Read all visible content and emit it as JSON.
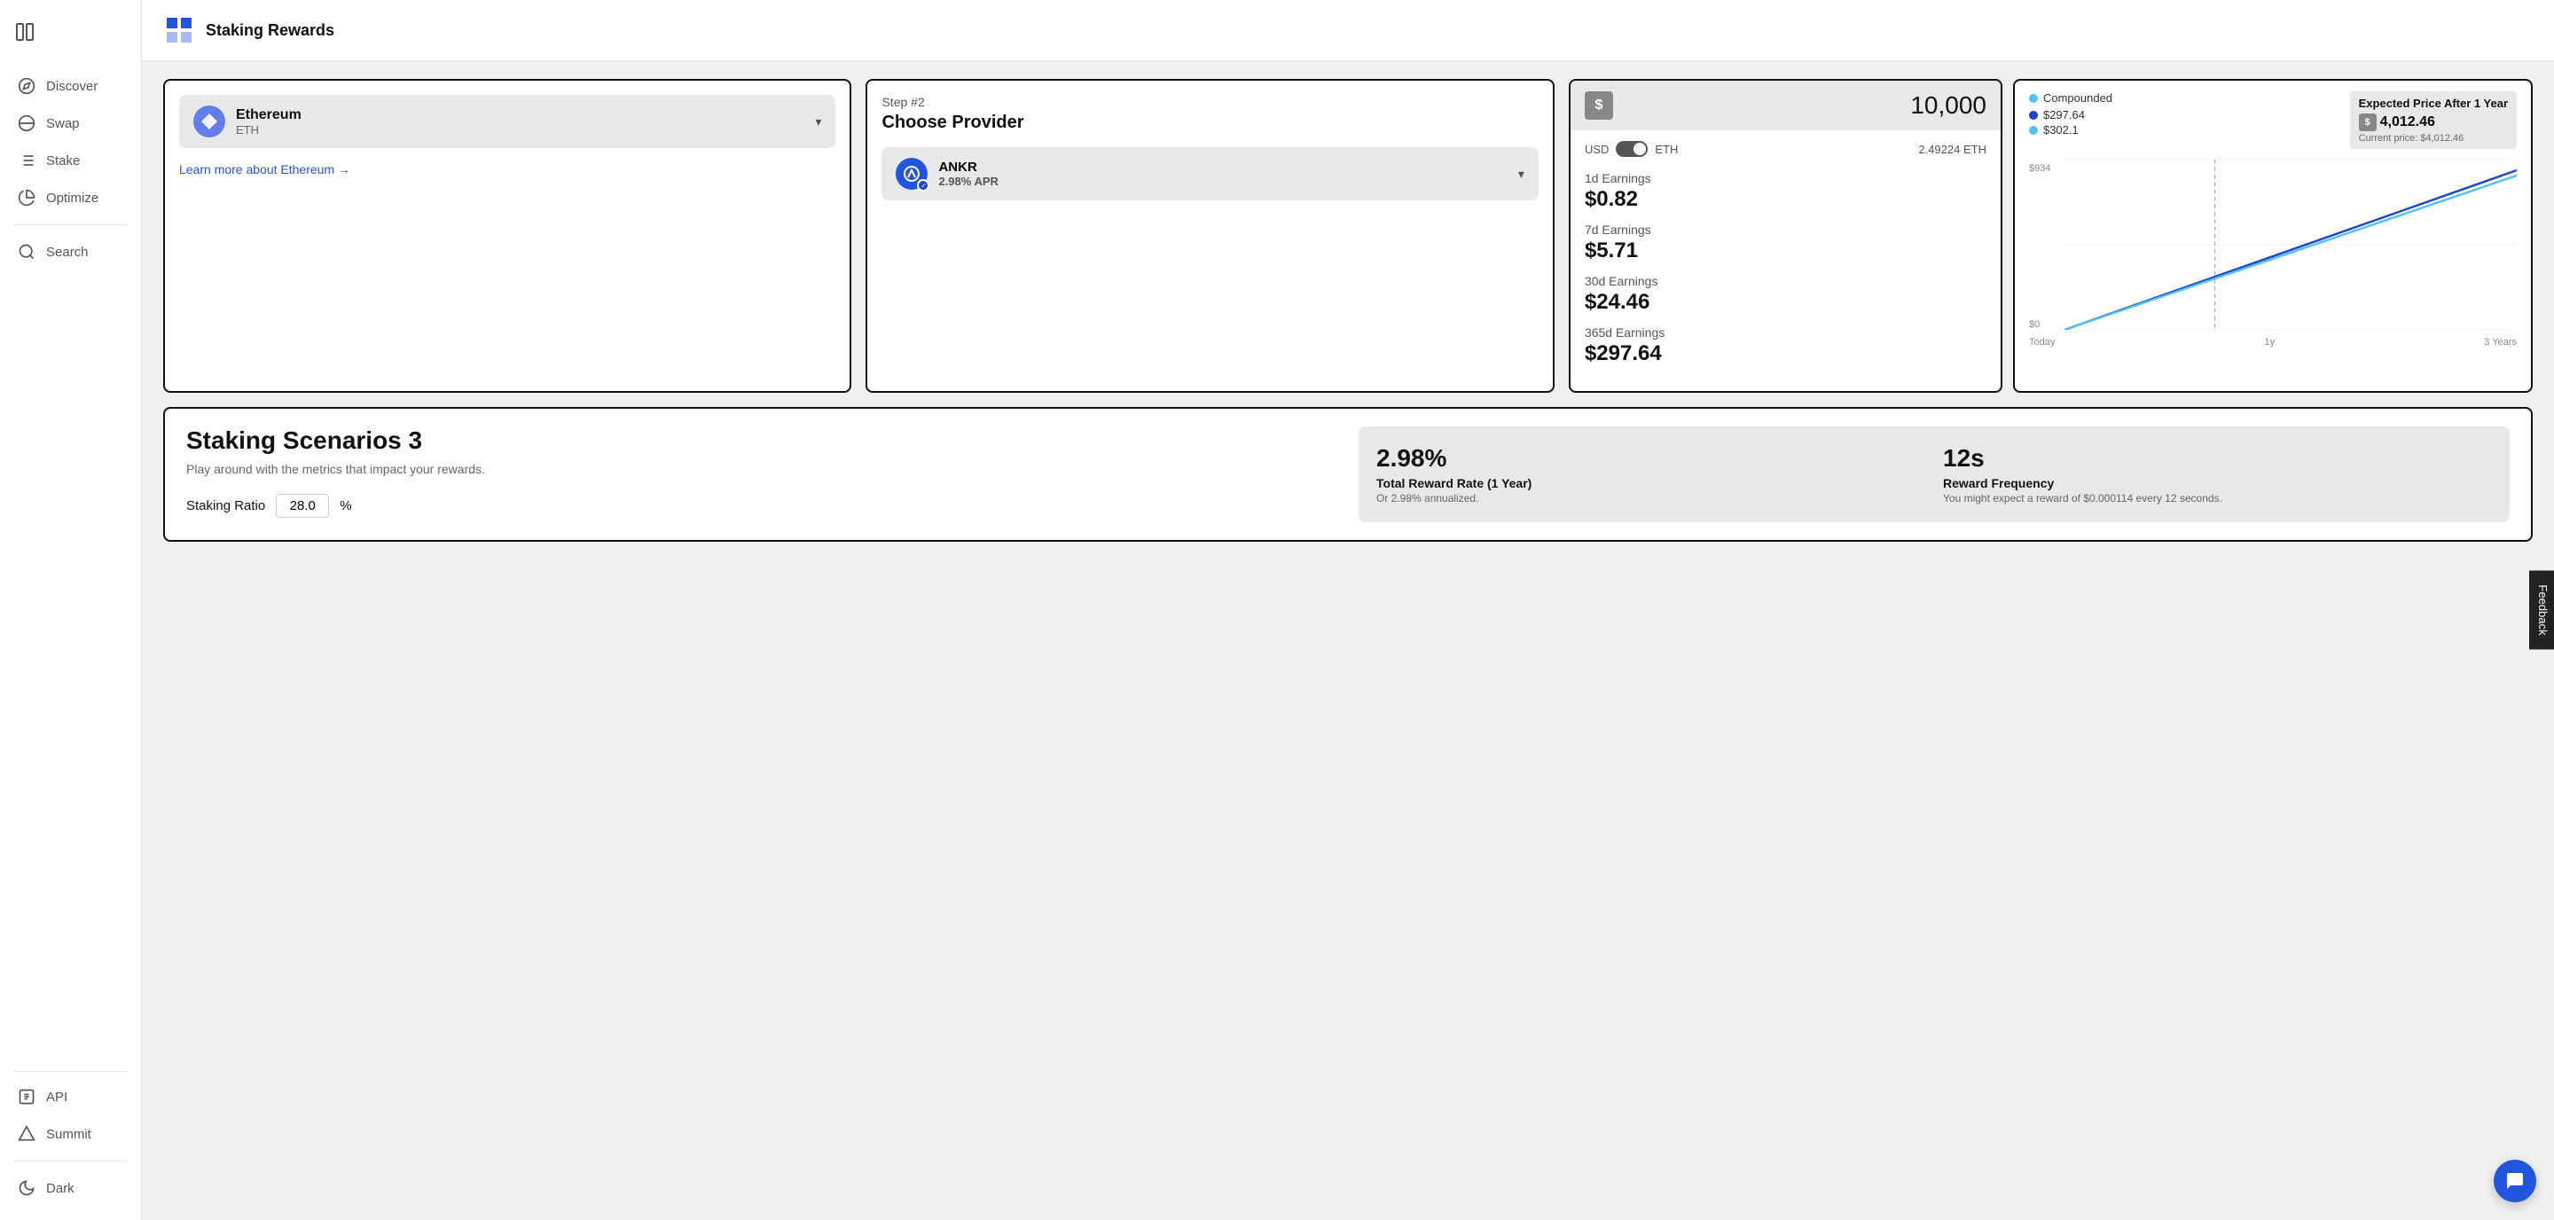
{
  "app": {
    "title": "Staking Rewards",
    "logo_alt": "Staking Rewards Logo"
  },
  "sidebar": {
    "toggle_label": "Toggle sidebar",
    "items": [
      {
        "id": "discover",
        "label": "Discover",
        "icon": "compass"
      },
      {
        "id": "swap",
        "label": "Swap",
        "icon": "swap"
      },
      {
        "id": "stake",
        "label": "Stake",
        "icon": "stake"
      },
      {
        "id": "optimize",
        "label": "Optimize",
        "icon": "optimize"
      },
      {
        "id": "search",
        "label": "Search",
        "icon": "search"
      }
    ],
    "bottom_items": [
      {
        "id": "api",
        "label": "API",
        "icon": "api"
      },
      {
        "id": "summit",
        "label": "Summit",
        "icon": "summit"
      },
      {
        "id": "dark",
        "label": "Dark",
        "icon": "moon"
      }
    ]
  },
  "asset_card": {
    "asset_name": "Ethereum",
    "asset_symbol": "ETH",
    "learn_more_text": "Learn more about Ethereum →"
  },
  "provider_card": {
    "step_label": "Step #2",
    "step_title": "Choose Provider",
    "provider_name": "ANKR",
    "provider_apr": "2.98% APR"
  },
  "earnings_card": {
    "amount": "10,000",
    "currency_usd": "USD",
    "currency_eth": "ETH",
    "eth_equivalent": "2.49224 ETH",
    "earnings": [
      {
        "period": "1d Earnings",
        "value": "$0.82"
      },
      {
        "period": "7d Earnings",
        "value": "$5.71"
      },
      {
        "period": "30d Earnings",
        "value": "$24.46"
      },
      {
        "period": "365d Earnings",
        "value": "$297.64"
      }
    ]
  },
  "chart_card": {
    "legend_compounded": "Compounded",
    "expected_label": "Expected Price After 1 Year",
    "expected_value": "4,012.46",
    "current_price": "Current price: $4,012.46",
    "data_points": [
      {
        "label": "$297.64",
        "color": "#1a44cc"
      },
      {
        "label": "$302.1",
        "color": "#4fc3f7"
      }
    ],
    "y_labels": [
      "$934",
      "$0"
    ],
    "x_labels": [
      "Today",
      "1y",
      "3 Years"
    ]
  },
  "scenarios": {
    "title": "Staking Scenarios 3",
    "description": "Play around with the metrics that impact your rewards.",
    "staking_ratio_label": "Staking Ratio",
    "staking_ratio_value": "28.0",
    "staking_ratio_unit": "%",
    "metrics": [
      {
        "value": "2.98%",
        "label": "Total Reward Rate (1 Year)",
        "sub": "Or 2.98% annualized."
      },
      {
        "value": "12s",
        "label": "Reward Frequency",
        "sub": "You might expect a reward of $0.000114 every 12 seconds."
      }
    ]
  },
  "feedback": {
    "label": "Feedback"
  },
  "chat": {
    "label": "💬"
  }
}
